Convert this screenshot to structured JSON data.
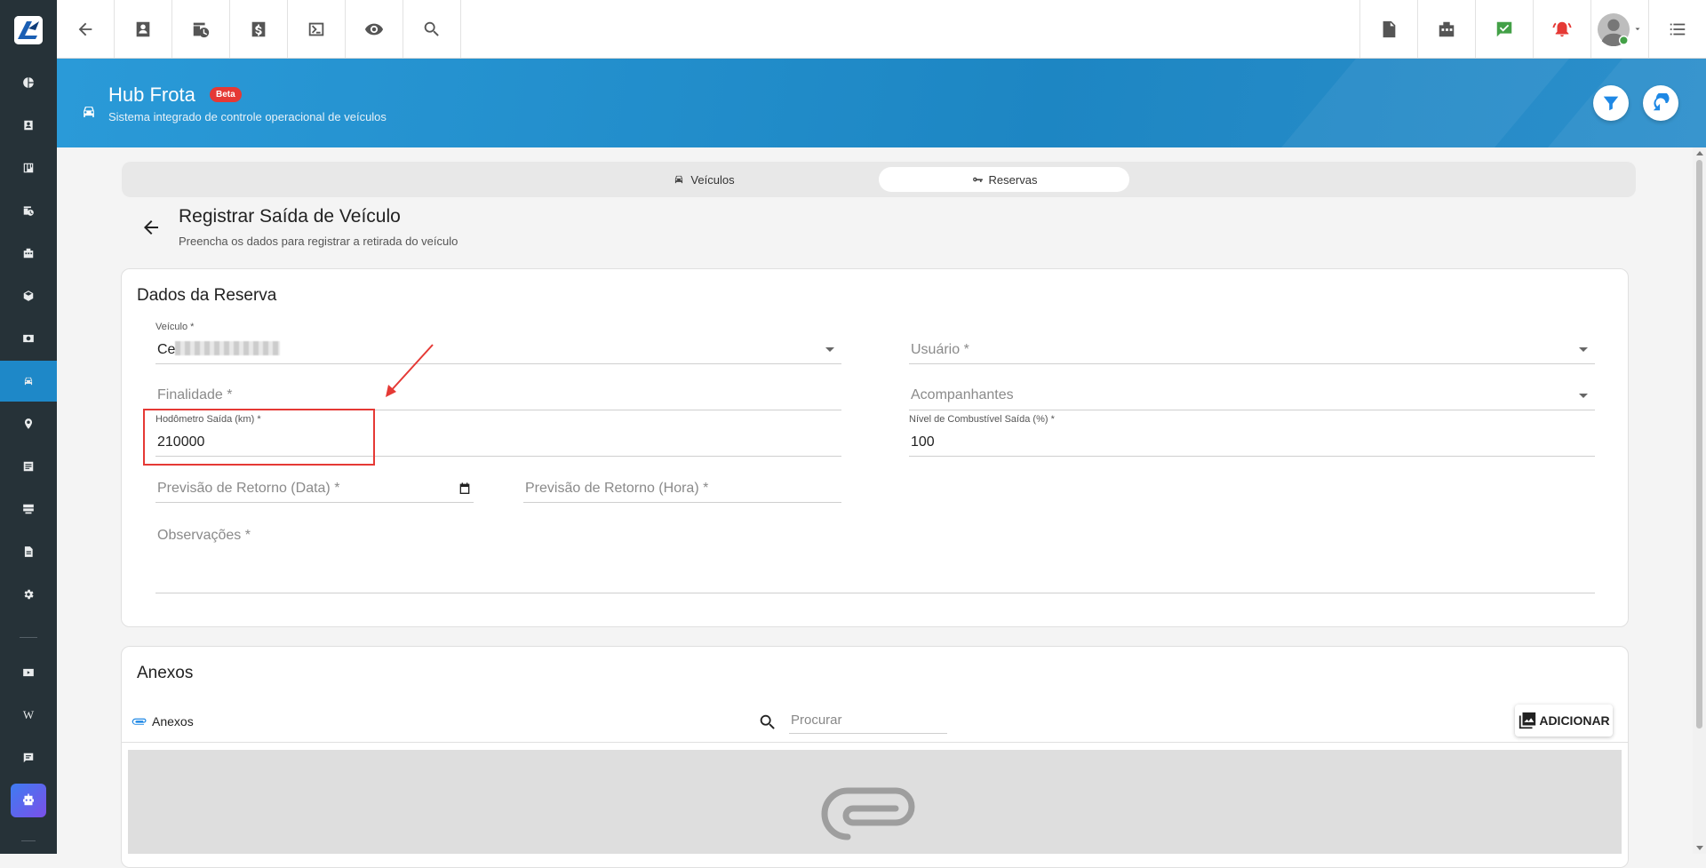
{
  "sidebar": {
    "items": [
      {
        "icon": "pie-chart-icon"
      },
      {
        "icon": "contact-card-icon"
      },
      {
        "icon": "kanban-icon"
      },
      {
        "icon": "calendar-clock-icon"
      },
      {
        "icon": "building-icon"
      },
      {
        "icon": "cube-icon"
      },
      {
        "icon": "money-icon"
      },
      {
        "icon": "car-icon",
        "active": true
      },
      {
        "icon": "map-pin-icon"
      },
      {
        "icon": "list-icon"
      },
      {
        "icon": "server-icon"
      },
      {
        "icon": "document-icon"
      },
      {
        "icon": "gear-icon"
      },
      {
        "icon": "video-icon"
      },
      {
        "icon": "wiki-icon"
      },
      {
        "icon": "chat-icon"
      }
    ],
    "wiki_label": "W"
  },
  "topbar": {
    "left_icons": [
      "back-arrow-icon",
      "contact-card-icon",
      "calendar-clock-icon",
      "dollar-icon",
      "terminal-icon",
      "eye-icon",
      "search-icon"
    ],
    "right_icons": [
      "pdf-icon",
      "building-icon",
      "chat-check-icon",
      "alarm-icon",
      "avatar",
      "menu-list-icon"
    ]
  },
  "banner": {
    "title": "Hub Frota",
    "badge": "Beta",
    "subtitle": "Sistema integrado de controle operacional de veículos"
  },
  "tabs": [
    {
      "label": "Veículos",
      "icon": "car-icon",
      "active": false
    },
    {
      "label": "Reservas",
      "icon": "key-icon",
      "active": true
    }
  ],
  "page": {
    "title": "Registrar Saída de Veículo",
    "subtitle": "Preencha os dados para registrar a retirada do veículo"
  },
  "form": {
    "section_title": "Dados da Reserva",
    "veiculo": {
      "label": "Veículo *",
      "value": "Ce"
    },
    "usuario": {
      "placeholder": "Usuário *"
    },
    "finalidade": {
      "placeholder": "Finalidade *"
    },
    "acompanhantes": {
      "placeholder": "Acompanhantes"
    },
    "hodometro": {
      "label": "Hodômetro Saída (km) *",
      "value": "210000"
    },
    "combustivel": {
      "label": "Nível de Combustível Saída (%) *",
      "value": "100"
    },
    "retorno_data": {
      "placeholder": "Previsão de Retorno (Data) *"
    },
    "retorno_hora": {
      "placeholder": "Previsão de Retorno (Hora) *"
    },
    "observacoes": {
      "placeholder": "Observações *"
    }
  },
  "anexos": {
    "section_title": "Anexos",
    "tab_label": "Anexos",
    "search_placeholder": "Procurar",
    "add_label": "ADICIONAR"
  },
  "colors": {
    "sidebar_bg": "#263238",
    "accent": "#1e88c8",
    "highlight": "#e53935",
    "badge": "#e53935",
    "status_green": "#43a047",
    "alert_red": "#e53935"
  }
}
